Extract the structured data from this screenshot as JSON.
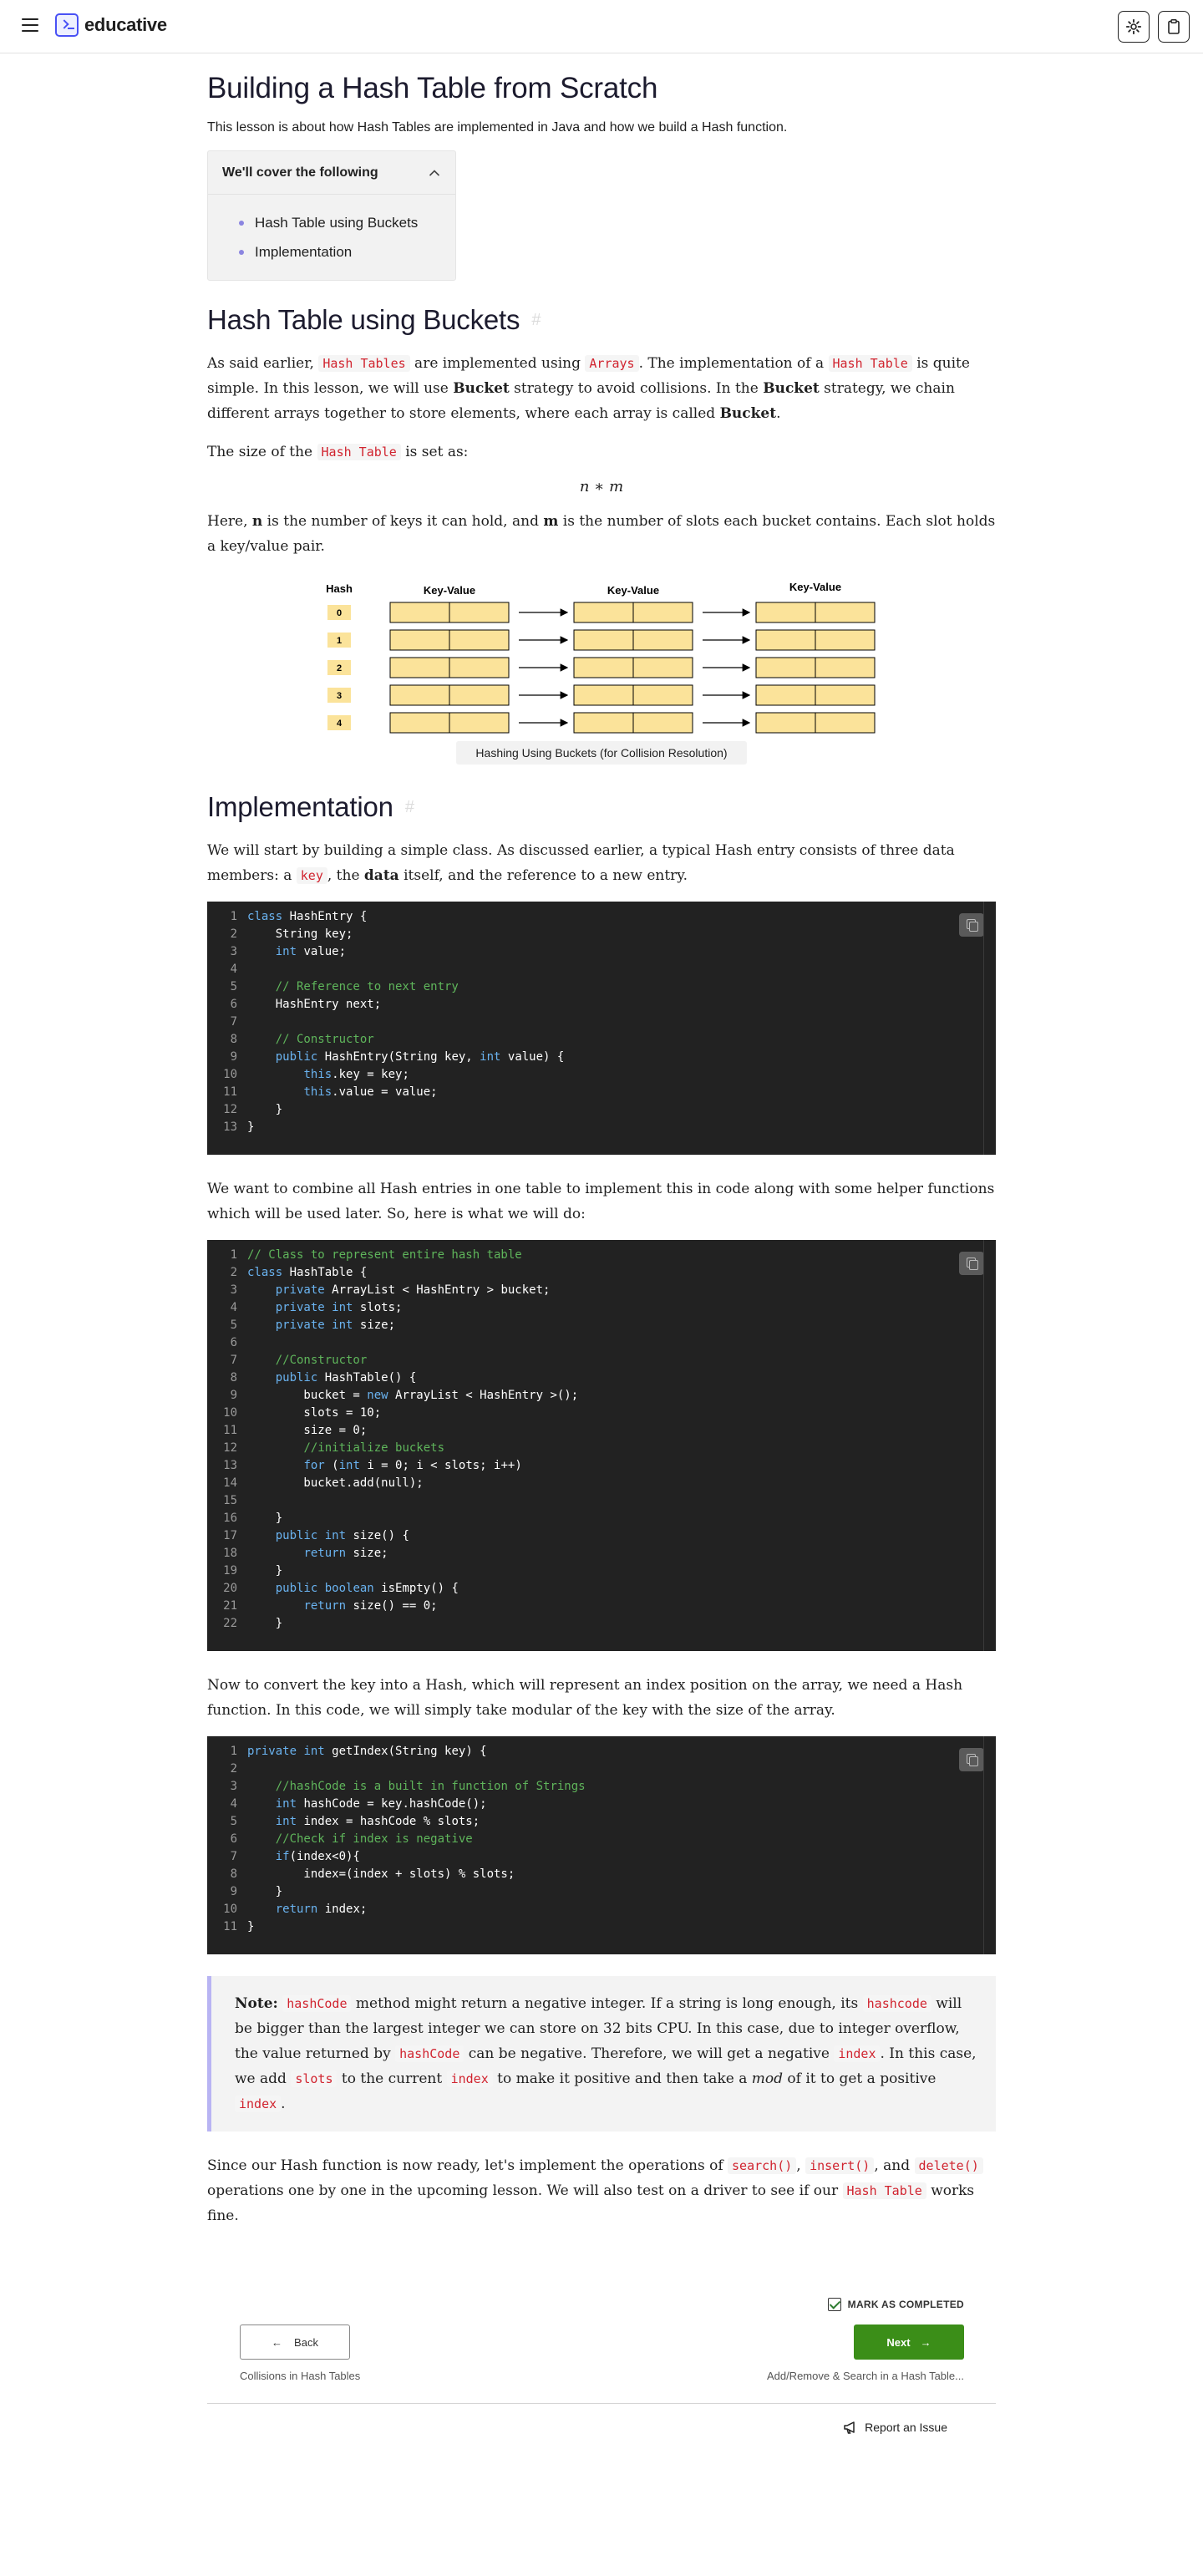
{
  "header": {
    "brand": "educative"
  },
  "lesson": {
    "title": "Building a Hash Table from Scratch",
    "intro": "This lesson is about how Hash Tables are implemented in Java and how we build a Hash function.",
    "toc": {
      "heading": "We'll cover the following",
      "items": [
        "Hash Table using Buckets",
        "Implementation"
      ]
    }
  },
  "section1": {
    "heading": "Hash Table using Buckets",
    "p1": {
      "t1": "As said earlier, ",
      "c1": "Hash Tables",
      "t2": " are implemented using ",
      "c2": "Arrays",
      "t3": ". The implementation of a ",
      "c3": "Hash Table",
      "t4": " is quite simple. In this lesson, we will use ",
      "b1": "Bucket",
      "t5": " strategy to avoid collisions. In the ",
      "b2": "Bucket",
      "t6": " strategy, we chain different arrays together to store elements, where each array is called ",
      "b3": "Bucket",
      "t7": "."
    },
    "p2": {
      "t1": "The size of the ",
      "c1": "Hash Table",
      "t2": " is set as:"
    },
    "formula": "n ∗ m",
    "p3": {
      "t1": "Here, ",
      "b1": "n",
      "t2": " is the number of keys it can hold, and ",
      "b2": "m",
      "t3": " is the number of slots each bucket contains. Each slot holds a key/value pair."
    },
    "figure": {
      "hash_header": "Hash",
      "kv_header": "Key-Value",
      "indices": [
        "0",
        "1",
        "2",
        "3",
        "4"
      ],
      "caption": "Hashing Using Buckets (for Collision Resolution)",
      "fill_color": "#fbe39a"
    }
  },
  "section2": {
    "heading": "Implementation",
    "p1": {
      "t1": "We will start by building a simple class. As discussed earlier, a typical Hash entry consists of three data members: a ",
      "c1": "key",
      "t2": ", the ",
      "b1": "data",
      "t3": " itself, and the reference to a new entry."
    },
    "code1": [
      [
        [
          "kw",
          "class"
        ],
        [
          "ty",
          " HashEntry {"
        ]
      ],
      [
        [
          "ty",
          "    String key;"
        ]
      ],
      [
        [
          "ty",
          "    "
        ],
        [
          "kw",
          "int"
        ],
        [
          "ty",
          " value;"
        ]
      ],
      [
        [
          "ty",
          ""
        ]
      ],
      [
        [
          "ty",
          "    "
        ],
        [
          "cm",
          "// Reference to next entry"
        ]
      ],
      [
        [
          "ty",
          "    HashEntry next;"
        ]
      ],
      [
        [
          "ty",
          ""
        ]
      ],
      [
        [
          "ty",
          "    "
        ],
        [
          "cm",
          "// Constructor"
        ]
      ],
      [
        [
          "ty",
          "    "
        ],
        [
          "kw",
          "public"
        ],
        [
          "ty",
          " HashEntry(String key, "
        ],
        [
          "kw",
          "int"
        ],
        [
          "ty",
          " value) {"
        ]
      ],
      [
        [
          "ty",
          "        "
        ],
        [
          "kw",
          "this"
        ],
        [
          "ty",
          ".key = key;"
        ]
      ],
      [
        [
          "ty",
          "        "
        ],
        [
          "kw",
          "this"
        ],
        [
          "ty",
          ".value = value;"
        ]
      ],
      [
        [
          "ty",
          "    }"
        ]
      ],
      [
        [
          "ty",
          "}"
        ]
      ]
    ],
    "p2": "We want to combine all Hash entries in one table to implement this in code along with some helper functions which will be used later. So, here is what we will do:",
    "code2": [
      [
        [
          "cm",
          "// Class to represent entire hash table"
        ]
      ],
      [
        [
          "kw",
          "class"
        ],
        [
          "ty",
          " HashTable {"
        ]
      ],
      [
        [
          "ty",
          "    "
        ],
        [
          "kw",
          "private"
        ],
        [
          "ty",
          " ArrayList < HashEntry > bucket;"
        ]
      ],
      [
        [
          "ty",
          "    "
        ],
        [
          "kw",
          "private"
        ],
        [
          "ty",
          " "
        ],
        [
          "kw",
          "int"
        ],
        [
          "ty",
          " slots;"
        ]
      ],
      [
        [
          "ty",
          "    "
        ],
        [
          "kw",
          "private"
        ],
        [
          "ty",
          " "
        ],
        [
          "kw",
          "int"
        ],
        [
          "ty",
          " size;"
        ]
      ],
      [
        [
          "ty",
          ""
        ]
      ],
      [
        [
          "ty",
          "    "
        ],
        [
          "cm",
          "//Constructor"
        ]
      ],
      [
        [
          "ty",
          "    "
        ],
        [
          "kw",
          "public"
        ],
        [
          "ty",
          " HashTable() {"
        ]
      ],
      [
        [
          "ty",
          "        bucket = "
        ],
        [
          "kw",
          "new"
        ],
        [
          "ty",
          " ArrayList < HashEntry >();"
        ]
      ],
      [
        [
          "ty",
          "        slots = 10;"
        ]
      ],
      [
        [
          "ty",
          "        size = 0;"
        ]
      ],
      [
        [
          "ty",
          "        "
        ],
        [
          "cm",
          "//initialize buckets"
        ]
      ],
      [
        [
          "ty",
          "        "
        ],
        [
          "kw",
          "for"
        ],
        [
          "ty",
          " ("
        ],
        [
          "kw",
          "int"
        ],
        [
          "ty",
          " i = 0; i < slots; i++)"
        ]
      ],
      [
        [
          "ty",
          "        bucket.add(null);"
        ]
      ],
      [
        [
          "ty",
          ""
        ]
      ],
      [
        [
          "ty",
          "    }"
        ]
      ],
      [
        [
          "ty",
          "    "
        ],
        [
          "kw",
          "public"
        ],
        [
          "ty",
          " "
        ],
        [
          "kw",
          "int"
        ],
        [
          "ty",
          " size() {"
        ]
      ],
      [
        [
          "ty",
          "        "
        ],
        [
          "kw",
          "return"
        ],
        [
          "ty",
          " size;"
        ]
      ],
      [
        [
          "ty",
          "    }"
        ]
      ],
      [
        [
          "ty",
          "    "
        ],
        [
          "kw",
          "public"
        ],
        [
          "ty",
          " "
        ],
        [
          "kw",
          "boolean"
        ],
        [
          "ty",
          " isEmpty() {"
        ]
      ],
      [
        [
          "ty",
          "        "
        ],
        [
          "kw",
          "return"
        ],
        [
          "ty",
          " size() == 0;"
        ]
      ],
      [
        [
          "ty",
          "    }"
        ]
      ]
    ],
    "p3": "Now to convert the key into a Hash, which will represent an index position on the array, we need a Hash function. In this code, we will simply take modular of the key with the size of the array.",
    "code3": [
      [
        [
          "kw",
          "private"
        ],
        [
          "ty",
          " "
        ],
        [
          "kw",
          "int"
        ],
        [
          "ty",
          " getIndex(String key) {"
        ]
      ],
      [
        [
          "ty",
          ""
        ]
      ],
      [
        [
          "ty",
          "    "
        ],
        [
          "cm",
          "//hashCode is a built in function of Strings"
        ]
      ],
      [
        [
          "ty",
          "    "
        ],
        [
          "kw",
          "int"
        ],
        [
          "ty",
          " hashCode = key.hashCode();"
        ]
      ],
      [
        [
          "ty",
          "    "
        ],
        [
          "kw",
          "int"
        ],
        [
          "ty",
          " index = hashCode % slots;"
        ]
      ],
      [
        [
          "ty",
          "    "
        ],
        [
          "cm",
          "//Check if index is negative"
        ]
      ],
      [
        [
          "ty",
          "    "
        ],
        [
          "kw",
          "if"
        ],
        [
          "ty",
          "(index<0){"
        ]
      ],
      [
        [
          "ty",
          "        index=(index + slots) % slots;"
        ]
      ],
      [
        [
          "ty",
          "    }"
        ]
      ],
      [
        [
          "ty",
          "    "
        ],
        [
          "kw",
          "return"
        ],
        [
          "ty",
          " index;"
        ]
      ],
      [
        [
          "ty",
          "}"
        ]
      ]
    ],
    "note": {
      "label": "Note:",
      "c1": "hashCode",
      "t1": " method might return a negative integer. If a string is long enough, its ",
      "c2": "hashcode",
      "t2": " will be bigger than the largest integer we can store on 32 bits CPU. In this case, due to integer overflow, the value returned by ",
      "c3": "hashCode",
      "t3": " can be negative. Therefore, we will get a negative ",
      "c4": "index",
      "t4": ". In this case, we add ",
      "c5": "slots",
      "t5": " to the current ",
      "c6": "index",
      "t6": " to make it positive and then take a ",
      "em": "mod",
      "t7": " of it to get a positive ",
      "c7": "index",
      "t8": "."
    },
    "p4": {
      "t1": "Since our Hash function is now ready, let's implement the operations of ",
      "c1": "search()",
      "t2": ", ",
      "c2": "insert()",
      "t3": ", and ",
      "c3": "delete()",
      "t4": " operations one by one in the upcoming lesson. We will also test on a driver to see if our ",
      "c4": "Hash Table",
      "t5": " works fine."
    }
  },
  "footer": {
    "mark_label": "MARK AS COMPLETED",
    "back_label": "Back",
    "next_label": "Next",
    "prev_title": "Collisions in Hash Tables",
    "next_title": "Add/Remove & Search in a Hash Table...",
    "report_label": "Report an Issue",
    "next_color": "#3b8e18"
  }
}
